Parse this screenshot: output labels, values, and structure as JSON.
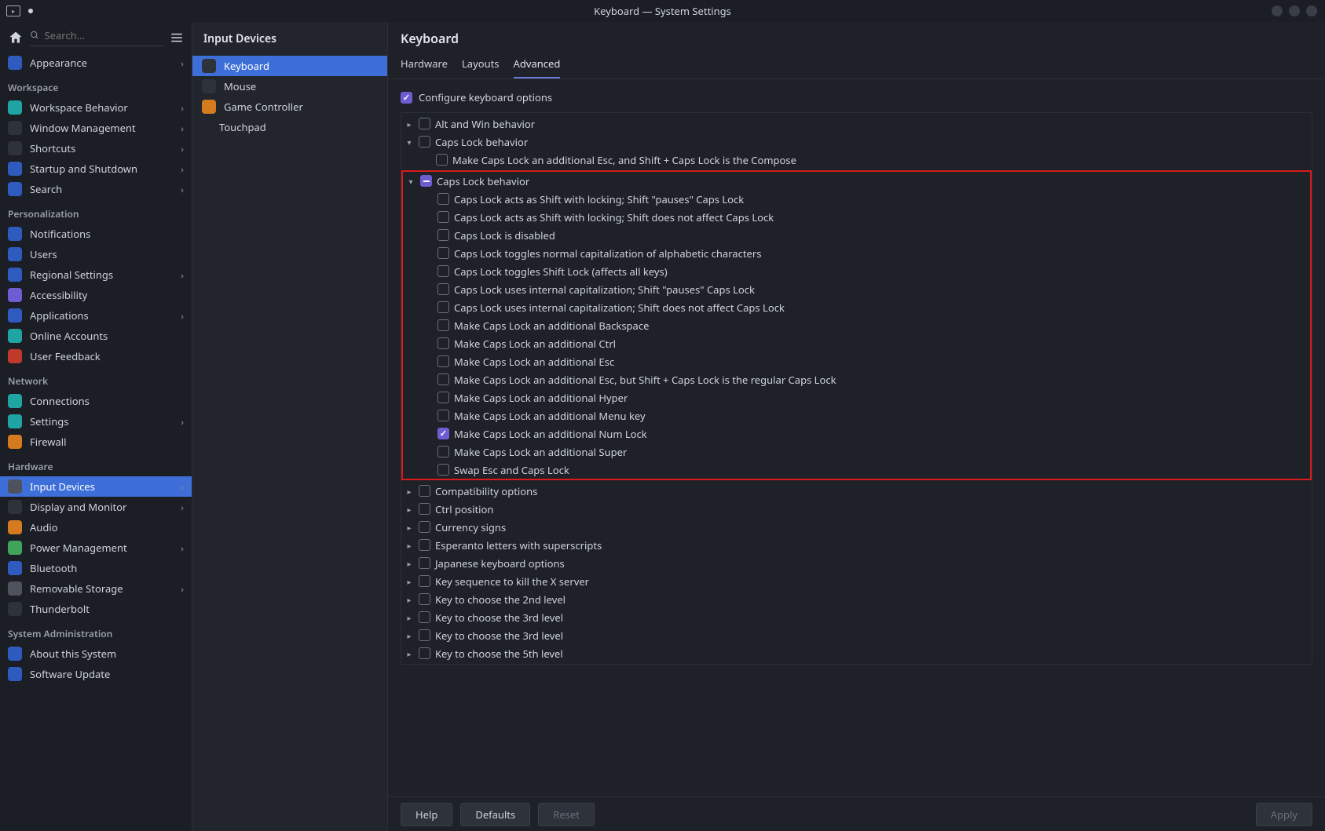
{
  "window": {
    "title": "Keyboard — System Settings"
  },
  "search": {
    "placeholder": "Search…"
  },
  "sidebar": {
    "groups": [
      {
        "label": "",
        "items": [
          {
            "label": "Appearance",
            "icon": "ic-blue",
            "chev": true
          }
        ]
      },
      {
        "label": "Workspace",
        "items": [
          {
            "label": "Workspace Behavior",
            "icon": "ic-teal",
            "chev": true
          },
          {
            "label": "Window Management",
            "icon": "ic-dkgray",
            "chev": true
          },
          {
            "label": "Shortcuts",
            "icon": "ic-dkgray",
            "chev": true
          },
          {
            "label": "Startup and Shutdown",
            "icon": "ic-blue",
            "chev": true
          },
          {
            "label": "Search",
            "icon": "ic-blue",
            "chev": true
          }
        ]
      },
      {
        "label": "Personalization",
        "items": [
          {
            "label": "Notifications",
            "icon": "ic-blue",
            "chev": false
          },
          {
            "label": "Users",
            "icon": "ic-blue",
            "chev": false
          },
          {
            "label": "Regional Settings",
            "icon": "ic-blue",
            "chev": true
          },
          {
            "label": "Accessibility",
            "icon": "ic-purple",
            "chev": false
          },
          {
            "label": "Applications",
            "icon": "ic-blue",
            "chev": true
          },
          {
            "label": "Online Accounts",
            "icon": "ic-teal",
            "chev": false
          },
          {
            "label": "User Feedback",
            "icon": "ic-red",
            "chev": false
          }
        ]
      },
      {
        "label": "Network",
        "items": [
          {
            "label": "Connections",
            "icon": "ic-teal",
            "chev": false
          },
          {
            "label": "Settings",
            "icon": "ic-teal",
            "chev": true
          },
          {
            "label": "Firewall",
            "icon": "ic-orange",
            "chev": false
          }
        ]
      },
      {
        "label": "Hardware",
        "items": [
          {
            "label": "Input Devices",
            "icon": "ic-gray",
            "chev": true,
            "selected": true
          },
          {
            "label": "Display and Monitor",
            "icon": "ic-dkgray",
            "chev": true
          },
          {
            "label": "Audio",
            "icon": "ic-orange",
            "chev": false
          },
          {
            "label": "Power Management",
            "icon": "ic-green",
            "chev": true
          },
          {
            "label": "Bluetooth",
            "icon": "ic-blue",
            "chev": false
          },
          {
            "label": "Removable Storage",
            "icon": "ic-gray",
            "chev": true
          },
          {
            "label": "Thunderbolt",
            "icon": "ic-dkgray",
            "chev": false
          }
        ]
      },
      {
        "label": "System Administration",
        "items": [
          {
            "label": "About this System",
            "icon": "ic-blue",
            "chev": false
          },
          {
            "label": "Software Update",
            "icon": "ic-blue",
            "chev": false
          }
        ]
      }
    ]
  },
  "midcol": {
    "header": "Input Devices",
    "items": [
      {
        "label": "Keyboard",
        "icon": "ic-dkgray",
        "selected": true
      },
      {
        "label": "Mouse",
        "icon": "ic-dkgray"
      },
      {
        "label": "Game Controller",
        "icon": "ic-orange"
      },
      {
        "label": "Touchpad",
        "icon": "",
        "sub": true
      }
    ]
  },
  "main": {
    "header": "Keyboard",
    "tabs": [
      {
        "label": "Hardware"
      },
      {
        "label": "Layouts"
      },
      {
        "label": "Advanced",
        "active": true
      }
    ],
    "configure": {
      "label": "Configure keyboard options",
      "checked": true
    },
    "tree": {
      "top_rows": [
        {
          "exp": "▸",
          "label": "Alt and Win behavior",
          "state": ""
        },
        {
          "exp": "▾",
          "label": "Caps Lock behavior",
          "state": ""
        },
        {
          "exp": "",
          "indent": 1,
          "label": "Make Caps Lock an additional Esc, and Shift + Caps Lock is the Compose",
          "state": ""
        }
      ],
      "highlight": {
        "header": {
          "exp": "▾",
          "label": "Caps Lock behavior",
          "state": "indet"
        },
        "children": [
          {
            "label": "Caps Lock acts as Shift with locking; Shift \"pauses\" Caps Lock",
            "state": ""
          },
          {
            "label": "Caps Lock acts as Shift with locking; Shift does not affect Caps Lock",
            "state": ""
          },
          {
            "label": "Caps Lock is disabled",
            "state": ""
          },
          {
            "label": "Caps Lock toggles normal capitalization of alphabetic characters",
            "state": ""
          },
          {
            "label": "Caps Lock toggles Shift Lock (affects all keys)",
            "state": ""
          },
          {
            "label": "Caps Lock uses internal capitalization; Shift \"pauses\" Caps Lock",
            "state": ""
          },
          {
            "label": "Caps Lock uses internal capitalization; Shift does not affect Caps Lock",
            "state": ""
          },
          {
            "label": "Make Caps Lock an additional Backspace",
            "state": ""
          },
          {
            "label": "Make Caps Lock an additional Ctrl",
            "state": ""
          },
          {
            "label": "Make Caps Lock an additional Esc",
            "state": ""
          },
          {
            "label": "Make Caps Lock an additional Esc, but Shift + Caps Lock is the regular Caps Lock",
            "state": ""
          },
          {
            "label": "Make Caps Lock an additional Hyper",
            "state": ""
          },
          {
            "label": "Make Caps Lock an additional Menu key",
            "state": ""
          },
          {
            "label": "Make Caps Lock an additional Num Lock",
            "state": "checked"
          },
          {
            "label": "Make Caps Lock an additional Super",
            "state": ""
          },
          {
            "label": "Swap Esc and Caps Lock",
            "state": ""
          }
        ]
      },
      "bottom_rows": [
        {
          "exp": "▸",
          "label": "Compatibility options"
        },
        {
          "exp": "▸",
          "label": "Ctrl position"
        },
        {
          "exp": "▸",
          "label": "Currency signs"
        },
        {
          "exp": "▸",
          "label": "Esperanto letters with superscripts"
        },
        {
          "exp": "▸",
          "label": "Japanese keyboard options"
        },
        {
          "exp": "▸",
          "label": "Key sequence to kill the X server"
        },
        {
          "exp": "▸",
          "label": "Key to choose the 2nd level"
        },
        {
          "exp": "▸",
          "label": "Key to choose the 3rd level"
        },
        {
          "exp": "▸",
          "label": "Key to choose the 3rd level"
        },
        {
          "exp": "▸",
          "label": "Key to choose the 5th level"
        }
      ]
    },
    "footer": {
      "help": "Help",
      "defaults": "Defaults",
      "reset": "Reset",
      "apply": "Apply"
    }
  }
}
